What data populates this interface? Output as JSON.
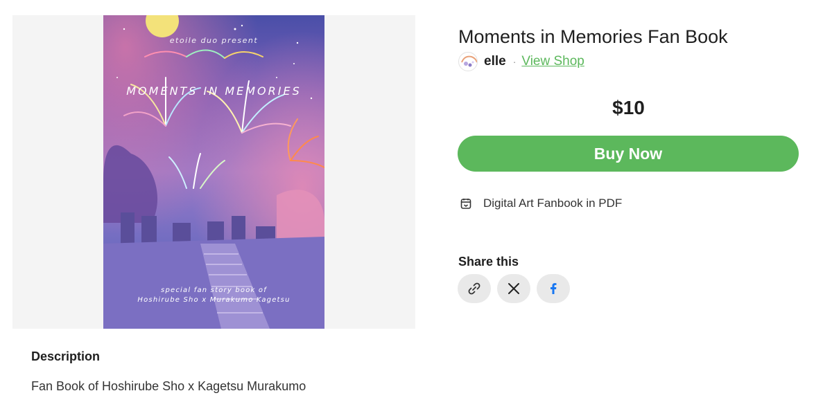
{
  "product": {
    "title": "Moments in Memories Fan Book",
    "price": "$10",
    "buy_label": "Buy Now",
    "format": "Digital Art Fanbook in PDF",
    "format_icon": "file-box-icon"
  },
  "seller": {
    "name": "elle",
    "separator": "·",
    "view_shop_label": "View Shop",
    "link_color": "#5cb85c"
  },
  "cover": {
    "presenter": "etoile duo present",
    "title": "MOMENTS IN MEMORIES",
    "subtitle_line1": "special fan story book of",
    "subtitle_line2": "Hoshirube Sho x Murakumo Kagetsu"
  },
  "share": {
    "heading": "Share this",
    "buttons": [
      {
        "icon": "link-icon"
      },
      {
        "icon": "x-icon"
      },
      {
        "icon": "facebook-icon"
      }
    ]
  },
  "description": {
    "heading": "Description",
    "text": "Fan Book of Hoshirube Sho x Kagetsu Murakumo"
  },
  "colors": {
    "accent": "#5cb85c",
    "share_bg": "#e9e9e9",
    "facebook": "#1877f2"
  }
}
